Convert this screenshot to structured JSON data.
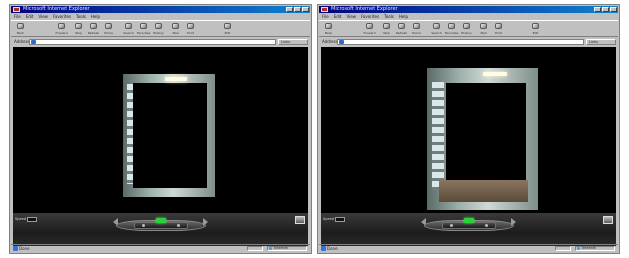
{
  "windows": [
    {
      "id": "left",
      "title": "Microsoft Internet Explorer",
      "menu": [
        "File",
        "Edit",
        "View",
        "Favorites",
        "Tools",
        "Help"
      ],
      "toolbar": [
        "Back",
        "Forward",
        "Stop",
        "Refresh",
        "Home",
        "Search",
        "Favorites",
        "History",
        "Mail",
        "Print",
        "Edit"
      ],
      "address_label": "Address",
      "address_value": "",
      "links_label": "Links",
      "speed_label": "Speed",
      "speed_value": "",
      "status_text": "Done",
      "zone_text": "Internet",
      "room_view": "frame-only"
    },
    {
      "id": "right",
      "title": "Microsoft Internet Explorer",
      "menu": [
        "File",
        "Edit",
        "View",
        "Favorites",
        "Tools",
        "Help"
      ],
      "toolbar": [
        "Back",
        "Forward",
        "Stop",
        "Refresh",
        "Home",
        "Search",
        "Favorites",
        "History",
        "Mail",
        "Print",
        "Edit"
      ],
      "address_label": "Address",
      "address_value": "",
      "links_label": "Links",
      "speed_label": "Speed",
      "speed_value": "",
      "status_text": "Done",
      "zone_text": "Internet",
      "room_view": "with-floor"
    }
  ],
  "colors": {
    "titlebar": "#000080",
    "viewport": "#000000",
    "chrome": "#c0c0c0",
    "indicator": "#2ad13a"
  }
}
